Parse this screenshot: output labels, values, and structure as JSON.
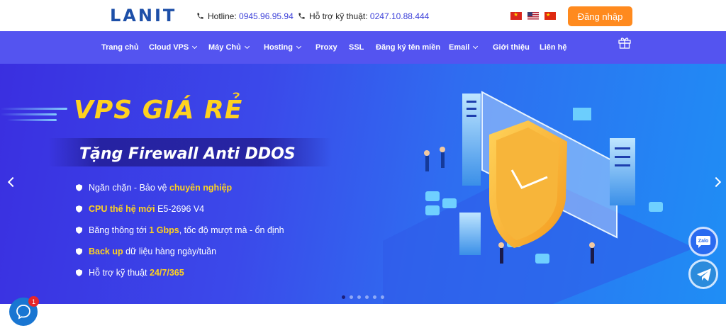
{
  "header": {
    "logo_text": "LANIT",
    "hotline_label": "Hotline:",
    "hotline_number": "0945.96.95.94",
    "support_label": "Hỗ trợ kỹ thuật:",
    "support_number": "0247.10.88.444",
    "login_label": "Đăng nhập",
    "flags": [
      "vietnam-flag-icon",
      "us-flag-icon",
      "china-flag-icon"
    ]
  },
  "nav": {
    "items": [
      {
        "label": "Trang chủ",
        "dropdown": false
      },
      {
        "label": "Cloud VPS",
        "dropdown": true
      },
      {
        "label": "Máy Chủ",
        "dropdown": true
      },
      {
        "label": "Hosting",
        "dropdown": true
      },
      {
        "label": "Proxy",
        "dropdown": false
      },
      {
        "label": "SSL",
        "dropdown": false
      },
      {
        "label": "Đăng ký tên miền",
        "dropdown": false
      },
      {
        "label": "Email",
        "dropdown": true
      },
      {
        "label": "Giới thiệu",
        "dropdown": false
      },
      {
        "label": "Liên hệ",
        "dropdown": false
      }
    ]
  },
  "banner": {
    "headline": "VPS GIÁ RẺ",
    "subtitle": "Tặng Firewall Anti DDOS",
    "features": [
      {
        "pre": "Ngăn chặn - Bảo vệ ",
        "hl": "chuyên nghiệp",
        "post": ""
      },
      {
        "pre": "",
        "hl": "CPU thế hệ mới",
        "post": " E5-2696 V4"
      },
      {
        "pre": "Băng thông tới ",
        "hl": "1 Gbps",
        "post": ", tốc độ mượt mà - ổn định"
      },
      {
        "pre": "",
        "hl": "Back up",
        "post": " dữ liệu hàng ngày/tuần"
      },
      {
        "pre": "Hỗ trợ kỹ thuật ",
        "hl": "24/7/365",
        "post": ""
      }
    ],
    "slide_count": 6,
    "active_slide": 0
  },
  "floating": {
    "zalo_label": "Zalo",
    "chat_badge": "1"
  },
  "colors": {
    "nav_bg": "#5454f0",
    "login_bg": "#ff8a1e",
    "highlight": "#ffd21f",
    "phone_number": "#3b3fd9"
  }
}
